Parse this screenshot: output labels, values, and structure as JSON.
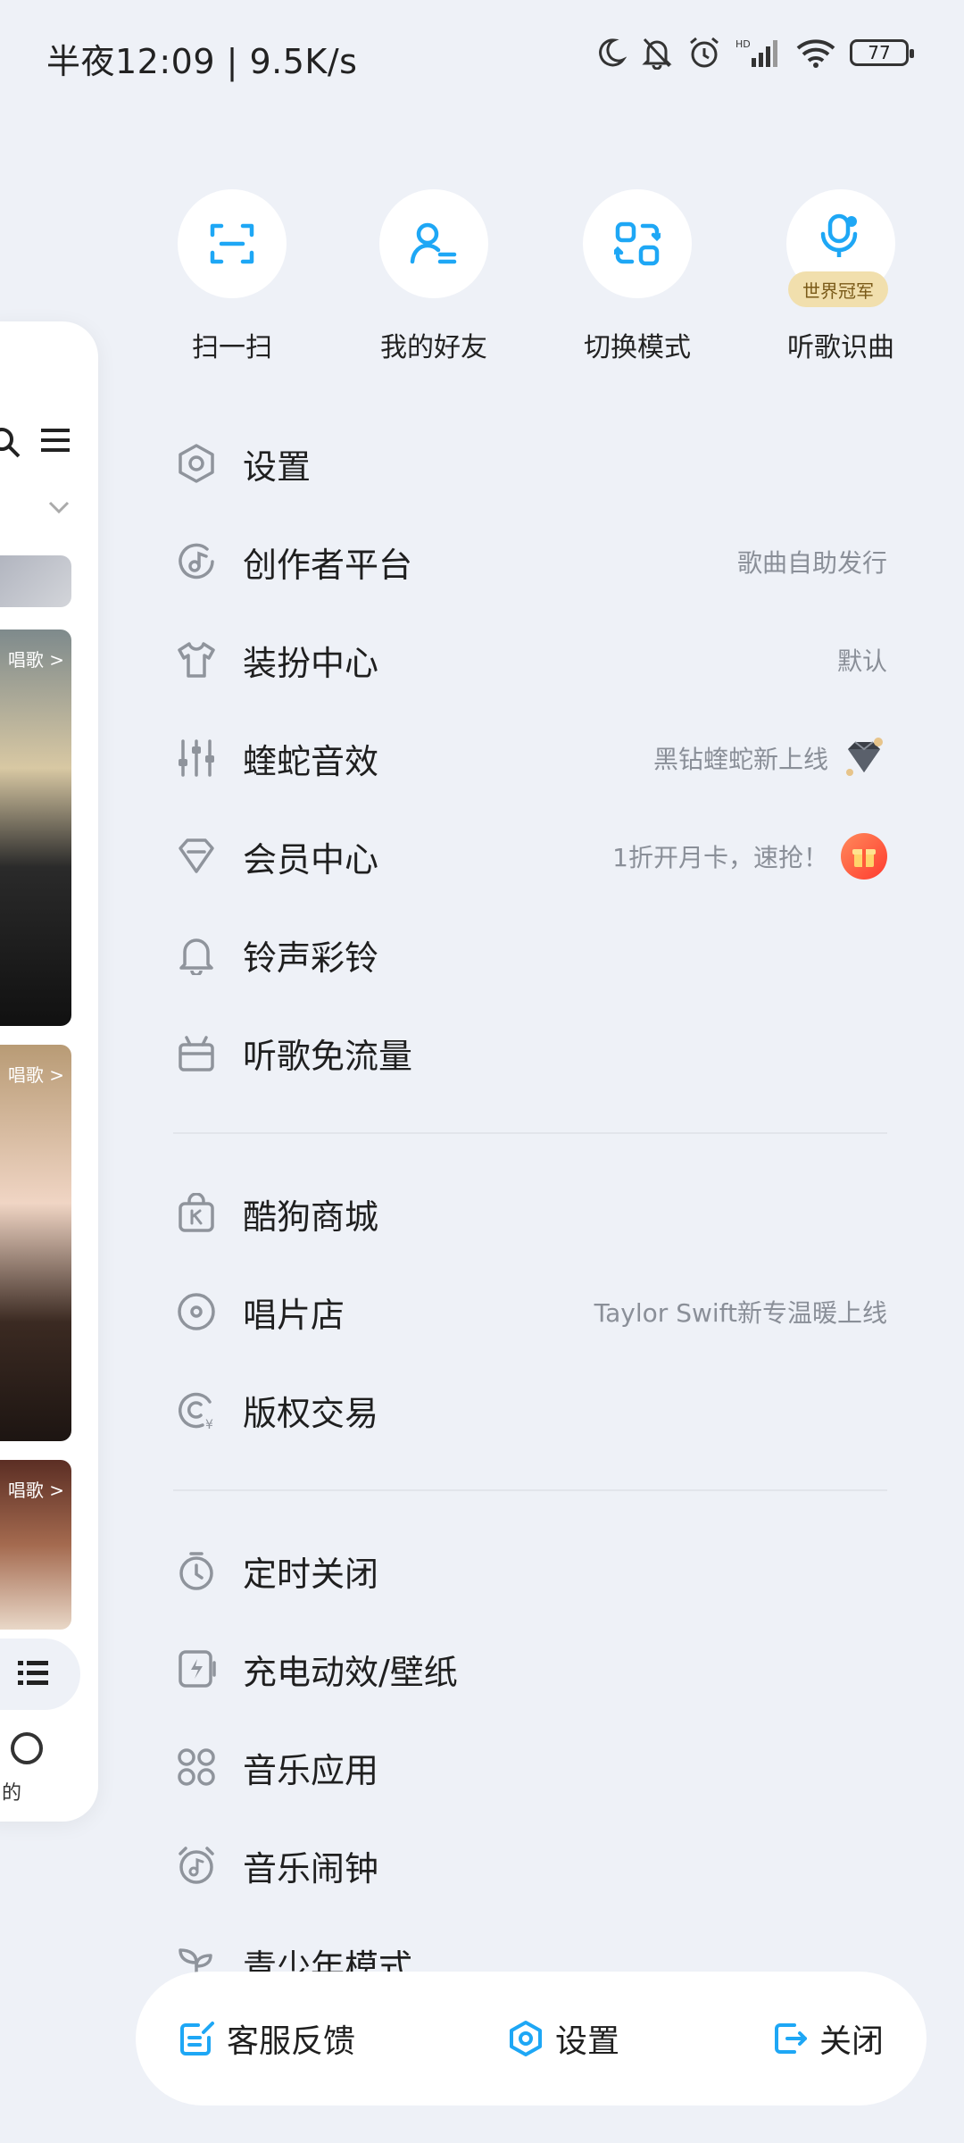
{
  "status_bar": {
    "time_speed": "半夜12:09 | 9.5K/s",
    "battery": "77",
    "icons": [
      "moon-icon",
      "bell-off-icon",
      "alarm-icon",
      "signal-icon",
      "wifi-icon",
      "battery-icon"
    ]
  },
  "background_preview": {
    "tags": [
      "唱歌 >",
      "唱歌 >",
      "唱歌 >"
    ],
    "bottom_label": "的"
  },
  "quick_actions": [
    {
      "label": "扫一扫",
      "icon": "scan-icon"
    },
    {
      "label": "我的好友",
      "icon": "friend-icon"
    },
    {
      "label": "切换模式",
      "icon": "switch-mode-icon"
    },
    {
      "label": "听歌识曲",
      "icon": "song-recognition-icon",
      "badge": "世界冠军"
    }
  ],
  "menu": {
    "group1": [
      {
        "label": "设置",
        "icon": "settings-icon"
      },
      {
        "label": "创作者平台",
        "icon": "creator-icon",
        "right": "歌曲自助发行"
      },
      {
        "label": "装扮中心",
        "icon": "tshirt-icon",
        "right": "默认"
      },
      {
        "label": "蝰蛇音效",
        "icon": "equalizer-icon",
        "right": "黑钻蝰蛇新上线"
      },
      {
        "label": "会员中心",
        "icon": "vip-diamond-icon",
        "right": "1折开月卡，速抢！"
      },
      {
        "label": "铃声彩铃",
        "icon": "bell-icon"
      },
      {
        "label": "听歌免流量",
        "icon": "gift-box-icon"
      }
    ],
    "group2": [
      {
        "label": "酷狗商城",
        "icon": "shop-bag-icon"
      },
      {
        "label": "唱片店",
        "icon": "record-icon",
        "right": "Taylor Swift新专温暖上线"
      },
      {
        "label": "版权交易",
        "icon": "copyright-icon"
      }
    ],
    "group3": [
      {
        "label": "定时关闭",
        "icon": "timer-icon"
      },
      {
        "label": "充电动效/壁纸",
        "icon": "charging-icon"
      },
      {
        "label": "音乐应用",
        "icon": "apps-icon"
      },
      {
        "label": "音乐闹钟",
        "icon": "music-alarm-icon"
      },
      {
        "label": "青少年模式",
        "icon": "sprout-icon"
      }
    ]
  },
  "bottom_bar": {
    "feedback": "客服反馈",
    "settings": "设置",
    "close": "关闭"
  },
  "colors": {
    "accent": "#1ea7f5",
    "background": "#eef1f7",
    "icon_gray": "#8f949c"
  }
}
